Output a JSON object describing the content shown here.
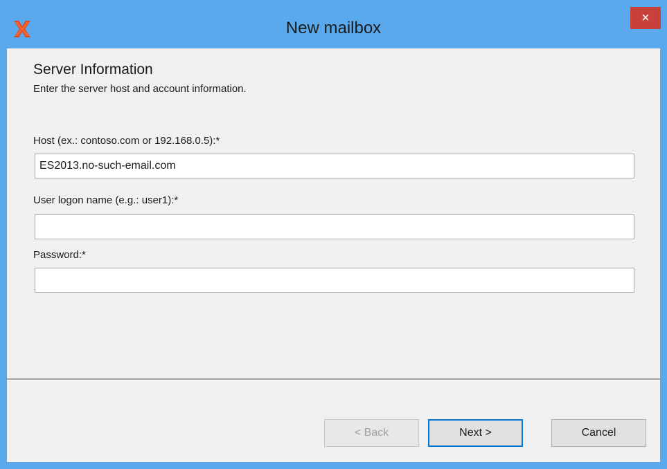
{
  "window": {
    "title": "New mailbox",
    "close_label": "×",
    "app_icon": "x-logo-icon",
    "accent_color": "#5aa9ec",
    "close_color": "#c7413a"
  },
  "section": {
    "title": "Server Information",
    "description": "Enter the server host and account information."
  },
  "fields": {
    "host": {
      "label": "Host (ex.: contoso.com or 192.168.0.5):*",
      "value": "ES2013.no-such-email.com"
    },
    "username": {
      "label": "User logon name (e.g.: user1):*",
      "value": ""
    },
    "password": {
      "label": "Password:*",
      "value": ""
    }
  },
  "buttons": {
    "back": "< Back",
    "next": "Next >",
    "cancel": "Cancel"
  }
}
